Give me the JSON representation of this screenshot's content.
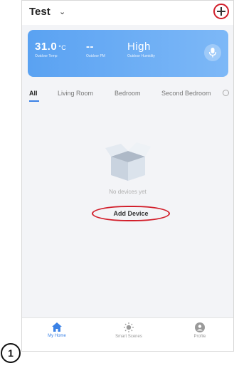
{
  "header": {
    "home_name": "Test",
    "caret": "⌄",
    "add_icon": "plus-icon"
  },
  "weather": {
    "temp_value": "31.0",
    "temp_unit": "°C",
    "temp_label": "Outdoor Temp",
    "pm_value": "--",
    "pm_label": "Outdoor PM",
    "humidity_value": "High",
    "humidity_label": "Outdoor Humidity",
    "mic_icon": "microphone-icon"
  },
  "tabs": [
    {
      "label": "All",
      "active": true
    },
    {
      "label": "Living Room",
      "active": false
    },
    {
      "label": "Bedroom",
      "active": false
    },
    {
      "label": "Second Bedroom",
      "active": false
    }
  ],
  "empty_state": {
    "message": "No devices yet",
    "button_label": "Add Device"
  },
  "bottom_nav": [
    {
      "label": "My Home",
      "icon": "home-icon",
      "active": true
    },
    {
      "label": "Smart Scenes",
      "icon": "sun-icon",
      "active": false
    },
    {
      "label": "Profile",
      "icon": "profile-icon",
      "active": false
    }
  ],
  "annotation": {
    "step_number": "1"
  },
  "colors": {
    "accent": "#3b82e6",
    "annotation_red": "#d21f2b",
    "weather_card": "#5aa2f2"
  }
}
